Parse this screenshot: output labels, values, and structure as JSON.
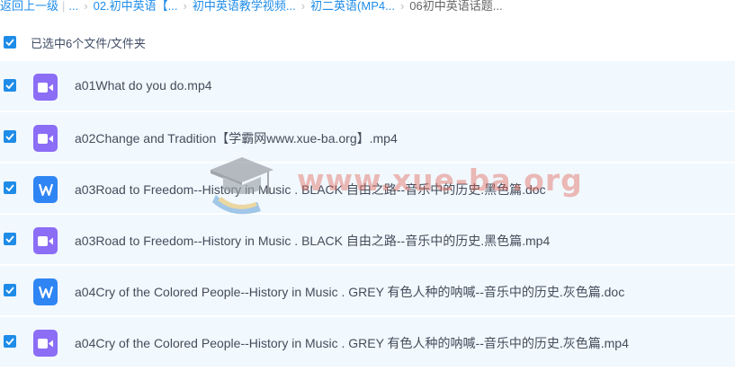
{
  "breadcrumb": {
    "back": "返回上一级",
    "ellipsis": "...",
    "items": [
      "02.初中英语【...",
      "初中英语教学视频...",
      "初二英语(MP4...",
      "06初中英语话题..."
    ]
  },
  "selection": {
    "label": "已选中6个文件/文件夹",
    "checked": true
  },
  "files": [
    {
      "name": "a01What do you do.mp4",
      "type": "video",
      "icon": "video-file-icon",
      "checked": true
    },
    {
      "name": "a02Change and Tradition【学霸网www.xue-ba.org】.mp4",
      "type": "video",
      "icon": "video-file-icon",
      "checked": true
    },
    {
      "name": "a03Road to Freedom--History in Music . BLACK 自由之路--音乐中的历史.黑色篇.doc",
      "type": "word",
      "icon": "word-file-icon",
      "icon_letter": "W",
      "checked": true
    },
    {
      "name": "a03Road to Freedom--History in Music . BLACK 自由之路--音乐中的历史.黑色篇.mp4",
      "type": "video",
      "icon": "video-file-icon",
      "checked": true
    },
    {
      "name": "a04Cry of the Colored People--History in Music . GREY 有色人种的呐喊--音乐中的历史.灰色篇.doc",
      "type": "word",
      "icon": "word-file-icon",
      "icon_letter": "W",
      "checked": true
    },
    {
      "name": "a04Cry of the Colored People--History in Music . GREY 有色人种的呐喊--音乐中的历史.灰色篇.mp4",
      "type": "video",
      "icon": "video-file-icon",
      "checked": true
    }
  ],
  "watermark": {
    "text": "www.xue-ba.org",
    "icon": "graduation-cap-logo-icon"
  },
  "colors": {
    "accent": "#1f8ce8",
    "row_bg": "#f1f8fe",
    "video_icon": "#8b6df6",
    "word_icon": "#2f85f3"
  }
}
